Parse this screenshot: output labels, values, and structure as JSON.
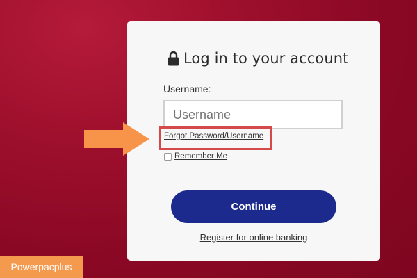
{
  "login": {
    "title": "Log in to your account",
    "lock_icon": "lock-icon",
    "username_label": "Username:",
    "username_placeholder": "Username",
    "forgot_link": "Forgot Password/Username",
    "remember_label": "Remember Me",
    "remember_checked": false,
    "continue_label": "Continue",
    "register_link": "Register for online banking"
  },
  "annotation": {
    "arrow_icon": "arrow-right-icon",
    "arrow_color": "#f7944a",
    "highlight_color": "#d44a4a"
  },
  "watermark": {
    "text": "Powerpacplus"
  },
  "colors": {
    "background": "#9c0f2c",
    "card": "#f7f7f7",
    "button": "#1b2a8c",
    "watermark_bg": "#f39a4f"
  }
}
